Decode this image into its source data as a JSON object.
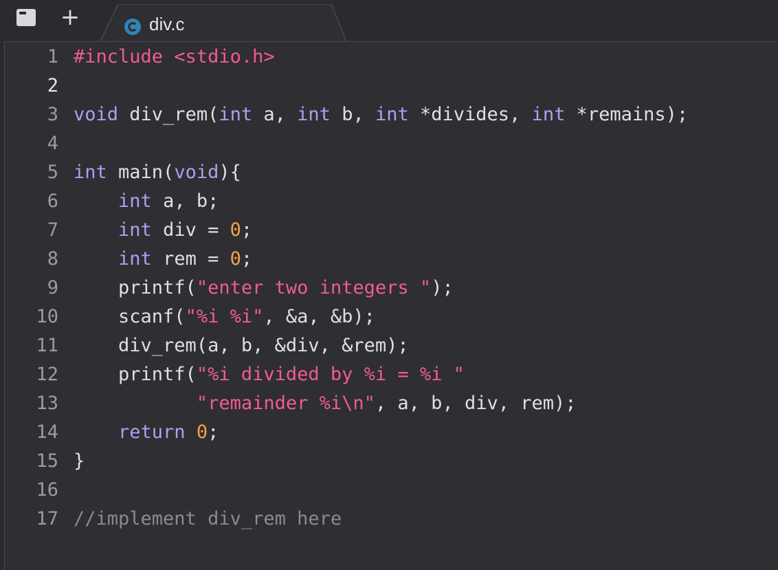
{
  "tabbar": {
    "sidebar_icon": "sidebar-toggle-icon",
    "new_tab_icon": "plus-icon",
    "tab": {
      "label": "div.c",
      "icon": "c-language-icon",
      "icon_color": "#2f85b8"
    }
  },
  "editor": {
    "current_line": 2,
    "lines": [
      {
        "n": "1",
        "tokens": [
          {
            "t": "#include <stdio.h>",
            "c": "pp"
          }
        ]
      },
      {
        "n": "2",
        "tokens": []
      },
      {
        "n": "3",
        "tokens": [
          {
            "t": "void",
            "c": "kw"
          },
          {
            "t": " div_rem(",
            "c": ""
          },
          {
            "t": "int",
            "c": "kw"
          },
          {
            "t": " a, ",
            "c": ""
          },
          {
            "t": "int",
            "c": "kw"
          },
          {
            "t": " b, ",
            "c": ""
          },
          {
            "t": "int",
            "c": "kw"
          },
          {
            "t": " *divides, ",
            "c": ""
          },
          {
            "t": "int",
            "c": "kw"
          },
          {
            "t": " *remains);",
            "c": ""
          }
        ]
      },
      {
        "n": "4",
        "tokens": []
      },
      {
        "n": "5",
        "tokens": [
          {
            "t": "int",
            "c": "kw"
          },
          {
            "t": " main(",
            "c": ""
          },
          {
            "t": "void",
            "c": "kw"
          },
          {
            "t": "){",
            "c": ""
          }
        ]
      },
      {
        "n": "6",
        "tokens": [
          {
            "t": "    ",
            "c": ""
          },
          {
            "t": "int",
            "c": "kw"
          },
          {
            "t": " a, b;",
            "c": ""
          }
        ]
      },
      {
        "n": "7",
        "tokens": [
          {
            "t": "    ",
            "c": ""
          },
          {
            "t": "int",
            "c": "kw"
          },
          {
            "t": " div = ",
            "c": ""
          },
          {
            "t": "0",
            "c": "num"
          },
          {
            "t": ";",
            "c": ""
          }
        ]
      },
      {
        "n": "8",
        "tokens": [
          {
            "t": "    ",
            "c": ""
          },
          {
            "t": "int",
            "c": "kw"
          },
          {
            "t": " rem = ",
            "c": ""
          },
          {
            "t": "0",
            "c": "num"
          },
          {
            "t": ";",
            "c": ""
          }
        ]
      },
      {
        "n": "9",
        "tokens": [
          {
            "t": "    printf(",
            "c": ""
          },
          {
            "t": "\"enter two integers \"",
            "c": "str"
          },
          {
            "t": ");",
            "c": ""
          }
        ]
      },
      {
        "n": "10",
        "tokens": [
          {
            "t": "    scanf(",
            "c": ""
          },
          {
            "t": "\"%i %i\"",
            "c": "str"
          },
          {
            "t": ", &a, &b);",
            "c": ""
          }
        ]
      },
      {
        "n": "11",
        "tokens": [
          {
            "t": "    div_rem(a, b, &div, &rem);",
            "c": ""
          }
        ]
      },
      {
        "n": "12",
        "tokens": [
          {
            "t": "    printf(",
            "c": ""
          },
          {
            "t": "\"%i divided by %i = %i \"",
            "c": "str"
          }
        ]
      },
      {
        "n": "13",
        "tokens": [
          {
            "t": "           ",
            "c": ""
          },
          {
            "t": "\"remainder %i\\n\"",
            "c": "str"
          },
          {
            "t": ", a, b, div, rem);",
            "c": ""
          }
        ]
      },
      {
        "n": "14",
        "tokens": [
          {
            "t": "    ",
            "c": ""
          },
          {
            "t": "return",
            "c": "kw"
          },
          {
            "t": " ",
            "c": ""
          },
          {
            "t": "0",
            "c": "num"
          },
          {
            "t": ";",
            "c": ""
          }
        ]
      },
      {
        "n": "15",
        "tokens": [
          {
            "t": "}",
            "c": ""
          }
        ]
      },
      {
        "n": "16",
        "tokens": []
      },
      {
        "n": "17",
        "tokens": [
          {
            "t": "//implement div_rem here",
            "c": "cm"
          }
        ]
      }
    ]
  }
}
